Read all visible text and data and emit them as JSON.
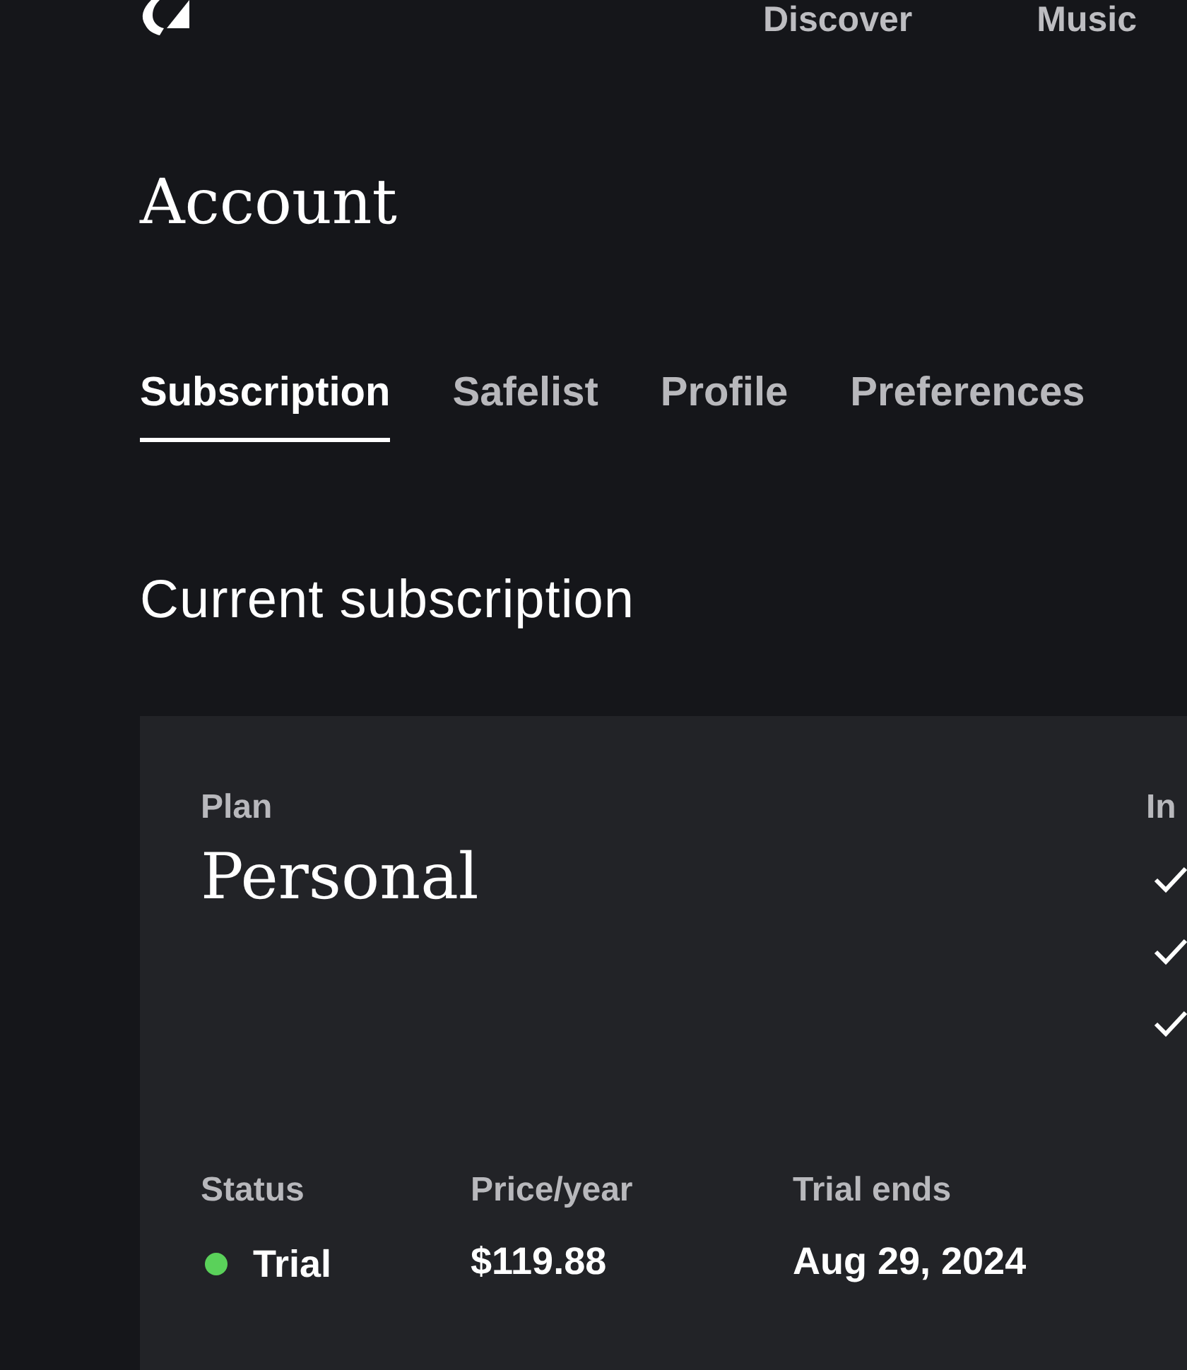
{
  "header": {
    "nav": [
      {
        "label": "Discover"
      },
      {
        "label": "Music"
      }
    ]
  },
  "page": {
    "title": "Account"
  },
  "tabs": [
    {
      "label": "Subscription",
      "selected": true
    },
    {
      "label": "Safelist",
      "selected": false
    },
    {
      "label": "Profile",
      "selected": false
    },
    {
      "label": "Preferences",
      "selected": false
    }
  ],
  "section": {
    "title": "Current subscription"
  },
  "card": {
    "plan": {
      "label": "Plan",
      "value": "Personal"
    },
    "included": {
      "label": "In"
    },
    "details": [
      {
        "kind": "status",
        "label": "Status",
        "value": "Trial",
        "color": "#5ad15a"
      },
      {
        "kind": "text",
        "label": "Price/year",
        "value": "$119.88"
      },
      {
        "kind": "text",
        "label": "Trial ends",
        "value": "Aug 29, 2024"
      }
    ]
  }
}
